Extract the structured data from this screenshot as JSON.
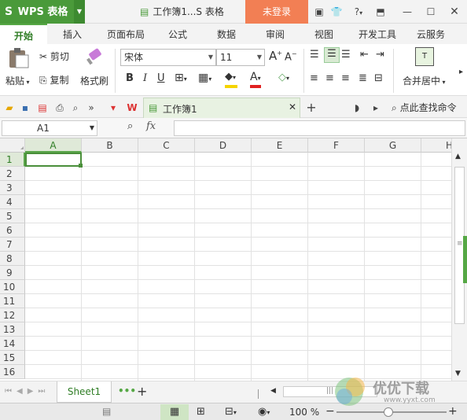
{
  "app": {
    "name": "WPS 表格",
    "doc_title": "工作簿1...S 表格",
    "login": "未登录"
  },
  "tabs": [
    "开始",
    "插入",
    "页面布局",
    "公式",
    "数据",
    "审阅",
    "视图",
    "开发工具",
    "云服务"
  ],
  "ribbon": {
    "paste": "粘贴",
    "cut": "剪切",
    "copy": "复制",
    "format_painter": "格式刷",
    "font": "宋体",
    "size": "11",
    "bold": "B",
    "italic": "I",
    "underline": "U",
    "font_color_letter": "A",
    "merge_center": "合并居中",
    "grow_font": "A",
    "shrink_font": "A",
    "colors": {
      "highlight": "#f5d400",
      "font_color": "#e02020"
    }
  },
  "quickbar": {
    "doc_tab": "工作簿1",
    "search": "点此查找命令"
  },
  "formula": {
    "cell_ref": "A1",
    "fx": "fx",
    "value": ""
  },
  "sheet": {
    "columns": [
      "A",
      "B",
      "C",
      "D",
      "E",
      "F",
      "G",
      "H"
    ],
    "rows": [
      "1",
      "2",
      "3",
      "4",
      "5",
      "6",
      "7",
      "8",
      "9",
      "10",
      "11",
      "12",
      "13",
      "14",
      "15",
      "16"
    ],
    "active_cell": "A1"
  },
  "sheetbar": {
    "tab": "Sheet1",
    "more": "•••",
    "add": "+"
  },
  "status": {
    "zoom": "100 %",
    "minus": "−",
    "plus": "+"
  },
  "watermark": {
    "text": "优优下载",
    "url": "www.yyxt.com"
  }
}
